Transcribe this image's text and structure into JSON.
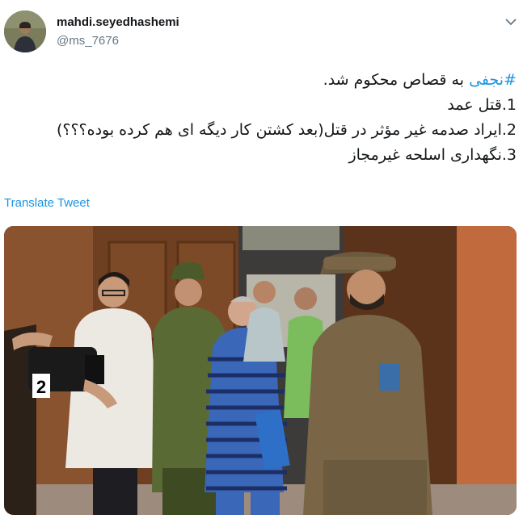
{
  "user": {
    "display_name": "mahdi.seyedhashemi",
    "handle": "@ms_7676"
  },
  "tweet": {
    "hashtag": "#نجفی",
    "line1_rest": " به قصاص محکوم شد.",
    "items": [
      "1.قتل عمد",
      "2.ایراد صدمه غیر مؤثر در قتل(بعد کشتن کار دیگه ای هم کرده بوده؟؟؟)",
      "3.نگهداری اسلحه غیرمجاز"
    ]
  },
  "translate_label": "Translate Tweet",
  "media": {
    "camera_badge": "2"
  },
  "icons": {
    "menu": "chevron-down-icon"
  },
  "colors": {
    "link": "#1b95e0",
    "secondary_text": "#657786"
  }
}
